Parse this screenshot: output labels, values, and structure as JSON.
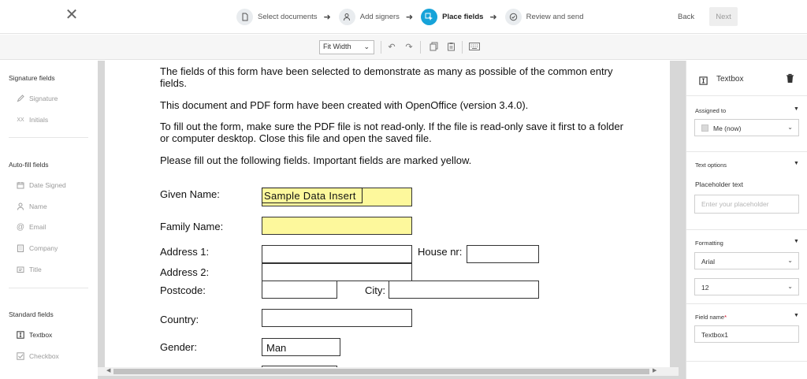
{
  "header": {
    "steps": [
      {
        "label": "Select documents",
        "icon": "document-icon",
        "state": "done"
      },
      {
        "label": "Add signers",
        "icon": "person-icon",
        "state": "done"
      },
      {
        "label": "Place fields",
        "icon": "cursor-icon",
        "state": "active"
      },
      {
        "label": "Review and send",
        "icon": "check-circle-icon",
        "state": "pending"
      }
    ],
    "back_label": "Back",
    "next_label": "Next",
    "accent_color": "#16a3d9"
  },
  "toolbar": {
    "zoom_value": "Fit Width"
  },
  "sidebar": {
    "signature_title": "Signature fields",
    "signature_items": [
      {
        "label": "Signature",
        "icon": "pen-icon"
      },
      {
        "label": "Initials",
        "icon": "initials-icon"
      }
    ],
    "autofill_title": "Auto-fill fields",
    "autofill_items": [
      {
        "label": "Date Signed",
        "icon": "calendar-icon"
      },
      {
        "label": "Name",
        "icon": "person-icon"
      },
      {
        "label": "Email",
        "icon": "at-icon"
      },
      {
        "label": "Company",
        "icon": "building-icon"
      },
      {
        "label": "Title",
        "icon": "id-card-icon"
      }
    ],
    "standard_title": "Standard fields",
    "standard_items": [
      {
        "label": "Textbox",
        "icon": "textbox-icon"
      },
      {
        "label": "Checkbox",
        "icon": "checkbox-icon"
      }
    ]
  },
  "document": {
    "para1": "The fields of this form have been selected to demonstrate as many as possible of the common entry fields.",
    "para2": "This document and PDF form have been created with OpenOffice (version 3.4.0).",
    "para3": "To fill out the form, make sure the PDF file is not read-only. If the file is read-only save it first to a folder or computer desktop. Close this file and open the saved file.",
    "para4": "Please fill out the following fields. Important fields are marked yellow.",
    "labels": {
      "given_name": "Given Name:",
      "family_name": "Family Name:",
      "address1": "Address 1:",
      "house_nr": "House nr:",
      "address2": "Address 2:",
      "postcode": "Postcode:",
      "city": "City:",
      "country": "Country:",
      "gender": "Gender:"
    },
    "placed_field_value": "Sample Data Insert",
    "gender_value": "Man"
  },
  "panel": {
    "title": "Textbox",
    "assigned_to_label": "Assigned to",
    "assigned_to_value": "Me (now)",
    "text_options_label": "Text options",
    "placeholder_label": "Placeholder text",
    "placeholder_hint": "Enter your placeholder",
    "formatting_label": "Formatting",
    "font_value": "Arial",
    "size_value": "12",
    "field_name_label": "Field name",
    "field_name_required": "*",
    "field_name_value": "Textbox1"
  }
}
